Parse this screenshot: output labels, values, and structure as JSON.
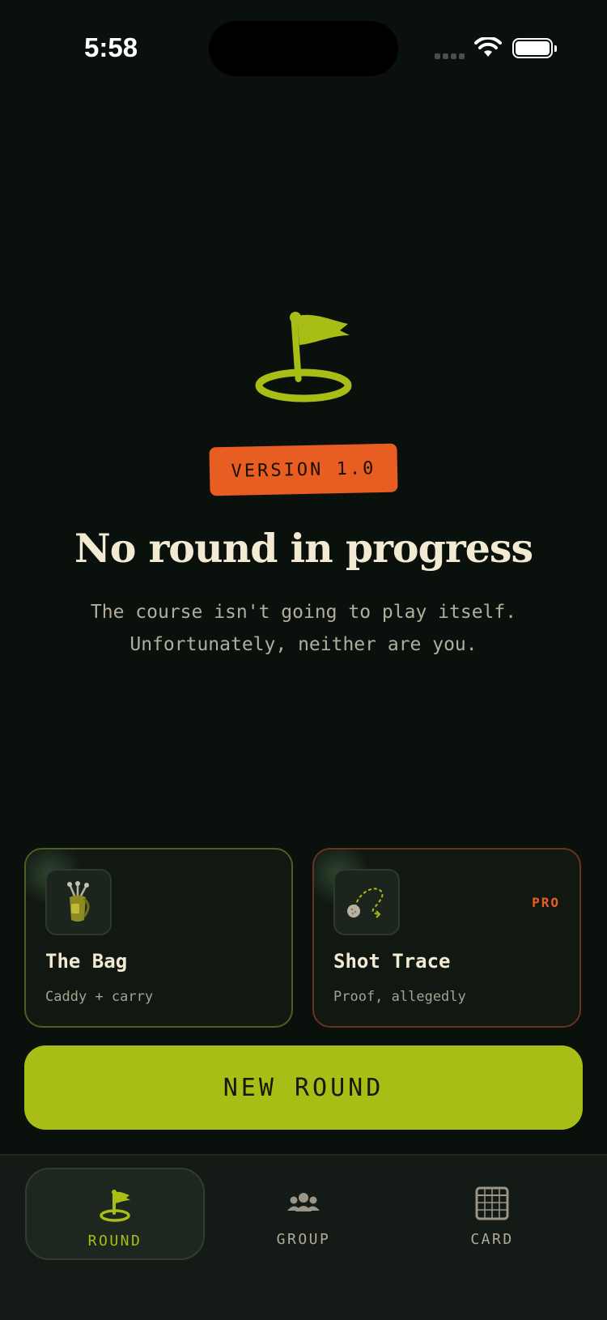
{
  "status_bar": {
    "time": "5:58"
  },
  "hero": {
    "icon": "golf-flag-hole-icon",
    "version_tag": "VERSION 1.0",
    "headline": "No round in progress",
    "subtitle_line1": "The course isn't going to play itself.",
    "subtitle_line2": "Unfortunately, neither are you."
  },
  "cards": [
    {
      "title": "The Bag",
      "caption": "Caddy + carry",
      "icon": "golf-bag-icon",
      "badge": ""
    },
    {
      "title": "Shot Trace",
      "caption": "Proof, allegedly",
      "icon": "ball-trace-icon",
      "badge": "PRO"
    }
  ],
  "primary_action": {
    "label": "NEW ROUND"
  },
  "tab_bar": {
    "tabs": [
      {
        "label": "ROUND",
        "icon": "flag-icon",
        "active": true
      },
      {
        "label": "GROUP",
        "icon": "group-icon",
        "active": false
      },
      {
        "label": "CARD",
        "icon": "scorecard-icon",
        "active": false
      }
    ]
  },
  "colors": {
    "background": "#0a110c",
    "accent": "#a9bd17",
    "orange": "#e85e22",
    "text": "#f3ead3"
  }
}
